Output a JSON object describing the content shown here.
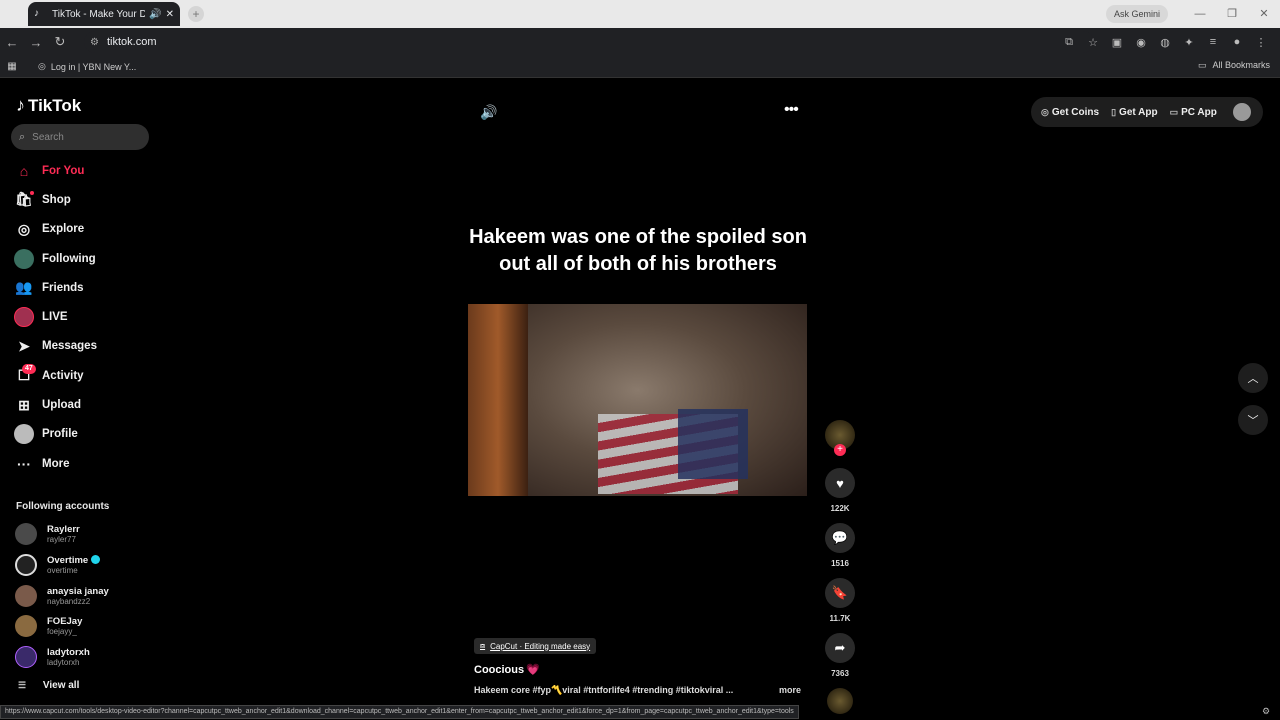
{
  "browser": {
    "tab_title": "TikTok - Make Your Day",
    "url": "tiktok.com",
    "ask_gemini": "Ask Gemini",
    "bookmark": "Log in | YBN New Y...",
    "all_bookmarks": "All Bookmarks",
    "status_url": "https://www.capcut.com/tools/desktop-video-editor?channel=capcutpc_ttweb_anchor_edit1&download_channel=capcutpc_ttweb_anchor_edit1&enter_from=capcutpc_ttweb_anchor_edit1&force_dp=1&from_page=capcutpc_ttweb_anchor_edit1&type=tools"
  },
  "sidebar": {
    "logo": "TikTok",
    "search_placeholder": "Search",
    "nav": [
      {
        "label": "For You",
        "icon": "home-icon"
      },
      {
        "label": "Shop",
        "icon": "shop-icon"
      },
      {
        "label": "Explore",
        "icon": "compass-icon"
      },
      {
        "label": "Following",
        "icon": "following-avatar"
      },
      {
        "label": "Friends",
        "icon": "friends-icon"
      },
      {
        "label": "LIVE",
        "icon": "live-avatar"
      },
      {
        "label": "Messages",
        "icon": "messages-icon"
      },
      {
        "label": "Activity",
        "icon": "activity-icon",
        "badge": "47"
      },
      {
        "label": "Upload",
        "icon": "upload-icon"
      },
      {
        "label": "Profile",
        "icon": "profile-avatar"
      },
      {
        "label": "More",
        "icon": "more-icon"
      }
    ],
    "following_title": "Following accounts",
    "following": [
      {
        "name": "Raylerr",
        "handle": "rayler77",
        "verified": false
      },
      {
        "name": "Overtime",
        "handle": "overtime",
        "verified": true
      },
      {
        "name": "anaysia janay",
        "handle": "naybandzz2",
        "verified": false
      },
      {
        "name": "FOEJay",
        "handle": "foejayy_",
        "verified": false
      },
      {
        "name": "ladytorxh",
        "handle": "ladytorxh",
        "verified": false
      }
    ],
    "view_all": "View all"
  },
  "video": {
    "caption": "Hakeem was one of the spoiled son out all of both of his brothers",
    "capcut": "CapCut · Editing made easy",
    "author": "Coocious",
    "author_emoji": "💗",
    "description": "Hakeem core #fyp〽️viral #tntforlife4 #trending #tiktokviral ...",
    "more": "more"
  },
  "actions": {
    "likes": "122K",
    "comments": "1516",
    "saves": "11.7K",
    "shares": "7363"
  },
  "topbar": {
    "get_coins": "Get Coins",
    "get_app": "Get App",
    "pc_app": "PC App"
  },
  "colors": {
    "accent": "#fe2c55",
    "background": "#000000"
  }
}
